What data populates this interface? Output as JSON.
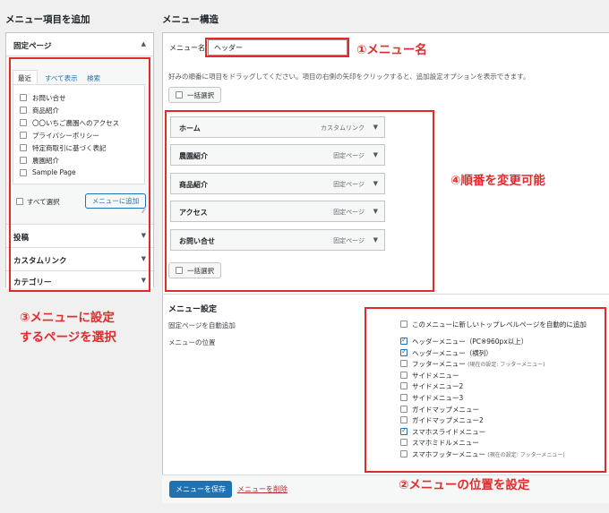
{
  "left": {
    "heading": "メニュー項目を追加",
    "fixed_page": {
      "title": "固定ページ",
      "tabs": [
        "最近",
        "すべて表示",
        "検索"
      ],
      "items": [
        {
          "label": "お問い合せ",
          "checked": false
        },
        {
          "label": "商品紹介",
          "checked": false
        },
        {
          "label": "〇〇いちご農園へのアクセス",
          "checked": false
        },
        {
          "label": "プライバシーポリシー",
          "checked": false
        },
        {
          "label": "特定商取引に基づく表記",
          "checked": false
        },
        {
          "label": "農園紹介",
          "checked": false
        },
        {
          "label": "Sample Page",
          "checked": false
        }
      ],
      "select_all": "すべて選択",
      "add_button": "メニューに追加"
    },
    "sections": [
      "投稿",
      "カスタムリンク",
      "カテゴリー"
    ]
  },
  "right": {
    "heading": "メニュー構造",
    "name_label": "メニュー名",
    "name_value": "ヘッダー",
    "hint": "好みの順番に項目をドラッグしてください。項目の右側の矢印をクリックすると、追加設定オプションを表示できます。",
    "bulk_select": "一括選択",
    "menu_items": [
      {
        "title": "ホーム",
        "type": "カスタムリンク"
      },
      {
        "title": "農園紹介",
        "type": "固定ページ"
      },
      {
        "title": "商品紹介",
        "type": "固定ページ"
      },
      {
        "title": "アクセス",
        "type": "固定ページ"
      },
      {
        "title": "お問い合せ",
        "type": "固定ページ"
      }
    ],
    "settings": {
      "heading": "メニュー設定",
      "auto_add_label": "固定ページを自動追加",
      "auto_add_option": "このメニューに新しいトップレベルページを自動的に追加",
      "location_label": "メニューの位置",
      "locations": [
        {
          "label": "ヘッダーメニュー（PC※960px以上）",
          "note": "",
          "checked": true
        },
        {
          "label": "ヘッダーメニュー（横列）",
          "note": "",
          "checked": true
        },
        {
          "label": "フッターメニュー",
          "note": "(現在の設定: フッターメニュー)",
          "checked": false
        },
        {
          "label": "サイドメニュー",
          "note": "",
          "checked": false
        },
        {
          "label": "サイドメニュー2",
          "note": "",
          "checked": false
        },
        {
          "label": "サイドメニュー3",
          "note": "",
          "checked": false
        },
        {
          "label": "ガイドマップメニュー",
          "note": "",
          "checked": false
        },
        {
          "label": "ガイドマップメニュー2",
          "note": "",
          "checked": false
        },
        {
          "label": "スマホスライドメニュー",
          "note": "",
          "checked": true
        },
        {
          "label": "スマホミドルメニュー",
          "note": "",
          "checked": false
        },
        {
          "label": "スマホフッターメニュー",
          "note": "(現在の設定: フッターメニュー)",
          "checked": false
        }
      ]
    },
    "save_button": "メニューを保存",
    "delete_link": "メニューを削除"
  },
  "annotations": {
    "a1": "①メニュー名",
    "a2": "②メニューの位置を設定",
    "a3_line1": "③メニューに設定",
    "a3_line2": "するページを選択",
    "a4": "④順番を変更可能"
  },
  "colors": {
    "annotation": "#e02b2b",
    "primary": "#2271b1"
  }
}
